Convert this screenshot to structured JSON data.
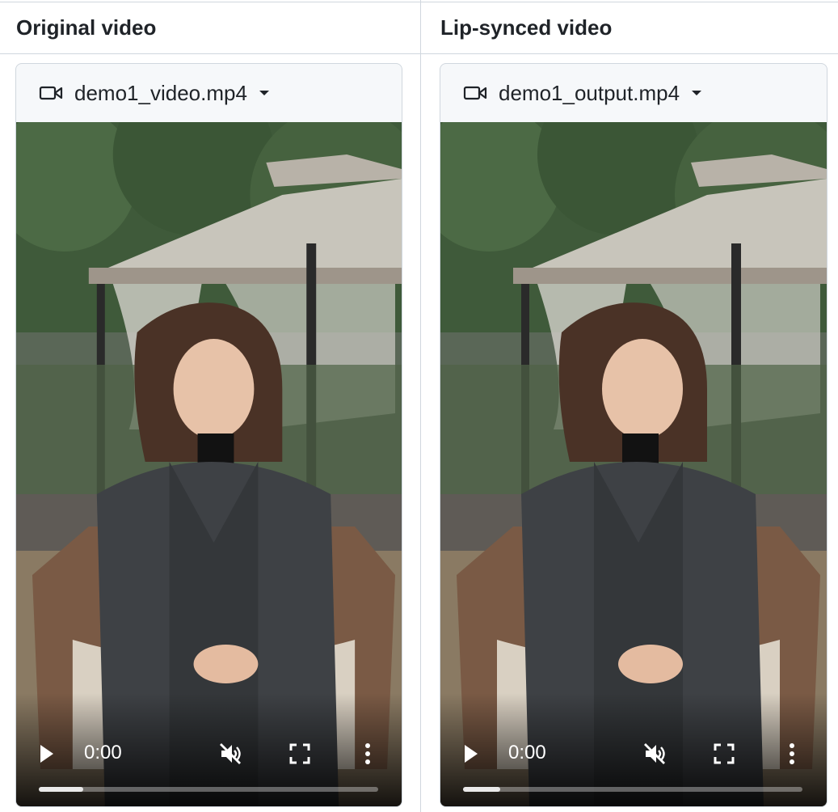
{
  "columns": [
    {
      "header": "Original video",
      "file_name": "demo1_video.mp4",
      "player": {
        "current_time": "0:00",
        "buffered_fraction": 0.13
      }
    },
    {
      "header": "Lip-synced video",
      "file_name": "demo1_output.mp4",
      "player": {
        "current_time": "0:00",
        "buffered_fraction": 0.11
      }
    }
  ],
  "icons": {
    "file": "video-camera-icon",
    "dropdown": "caret-down-icon",
    "play": "play-icon",
    "mute": "muted-speaker-icon",
    "fullscreen": "fullscreen-icon",
    "more": "kebab-menu-icon"
  },
  "colors": {
    "border": "#d0d7de",
    "card_bg": "#f6f8fa",
    "text": "#1f2328"
  }
}
